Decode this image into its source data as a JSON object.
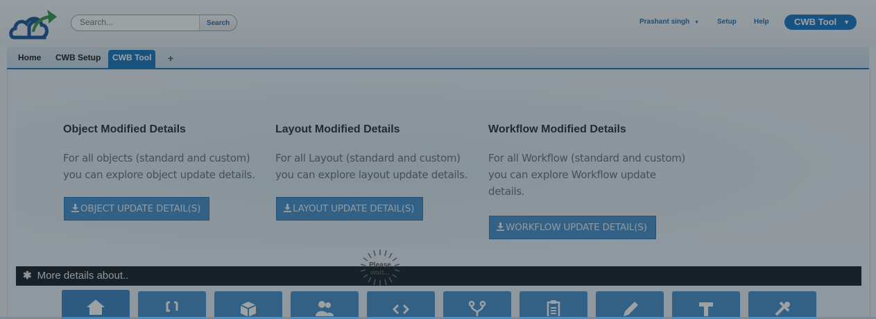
{
  "header": {
    "search": {
      "placeholder": "Search...",
      "button_label": "Search"
    },
    "user_name": "Prashant singh",
    "user_caret": "▼",
    "setup_label": "Setup",
    "help_label": "Help",
    "app_switcher": {
      "label": "CWB Tool",
      "caret": "▼"
    }
  },
  "tabs": [
    {
      "label": "Home"
    },
    {
      "label": "CWB Setup"
    },
    {
      "label": "CWB Tool"
    }
  ],
  "tab_plus": "+",
  "sections": [
    {
      "title": "Object Modified Details",
      "description": "For all objects (standard and custom) you can explore object update details.",
      "button": "OBJECT UPDATE DETAIL(S)"
    },
    {
      "title": "Layout Modified Details",
      "description": "For all Layout (standard and custom) you can explore layout update details.",
      "button": "LAYOUT UPDATE DETAIL(S)"
    },
    {
      "title": "Workflow Modified Details",
      "description": "For all Workflow (standard and custom) you can explore Workflow update details.",
      "button": "WORKFLOW UPDATE DETAIL(S)"
    }
  ],
  "more_details": {
    "icon": "asterisk-icon",
    "label": "More details about.."
  },
  "loading": {
    "line1": "Please",
    "line2": "wait..."
  },
  "colors": {
    "accent": "#1c79c0",
    "button": "#4a91cc",
    "bar": "#1a2329"
  }
}
